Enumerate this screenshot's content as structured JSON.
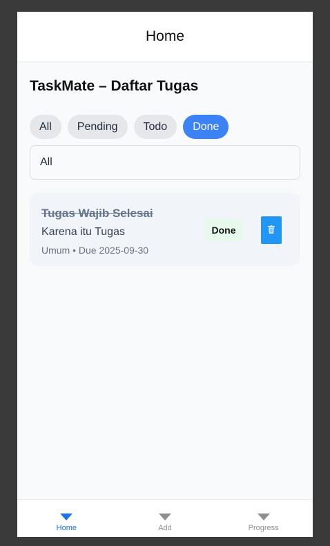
{
  "header": {
    "title": "Home"
  },
  "page": {
    "title": "TaskMate – Daftar Tugas"
  },
  "filters": {
    "chips": [
      {
        "label": "All",
        "active": false
      },
      {
        "label": "Pending",
        "active": false
      },
      {
        "label": "Todo",
        "active": false
      },
      {
        "label": "Done",
        "active": true
      }
    ],
    "selected_value": "All"
  },
  "tasks": [
    {
      "title": "Tugas Wajib Selesai",
      "description": "Karena itu Tugas",
      "meta": "Umum • Due 2025-09-30",
      "status": "Done"
    }
  ],
  "icons": {
    "delete": "trash-icon"
  },
  "nav": {
    "items": [
      {
        "label": "Home",
        "active": true,
        "icon": "triangle-down-icon"
      },
      {
        "label": "Add",
        "active": false,
        "icon": "triangle-down-icon"
      },
      {
        "label": "Progress",
        "active": false,
        "icon": "triangle-down-icon"
      }
    ]
  },
  "colors": {
    "accent": "#3b82f6",
    "nav_active": "#1a73e8",
    "delete_button": "#2196f3",
    "done_badge_bg": "#e6f9ea"
  }
}
